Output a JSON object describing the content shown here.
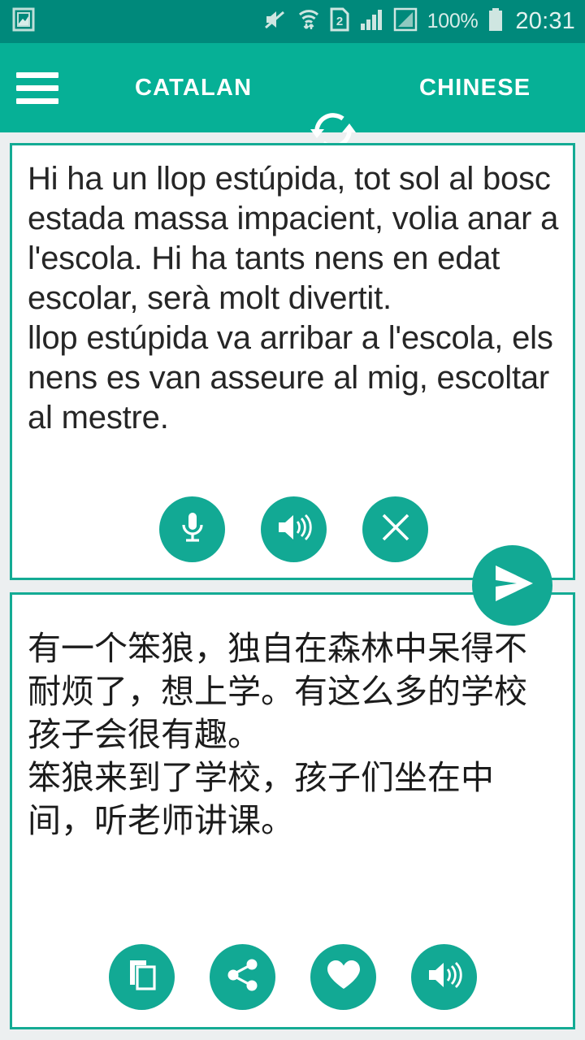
{
  "status_bar": {
    "notification_icon": "image-icon",
    "icons": [
      "mute-icon",
      "wifi-data-icon",
      "sim-2-icon",
      "signal-bars-icon",
      "signal-box-icon"
    ],
    "battery_percent": "100%",
    "battery_icon": "battery-full-icon",
    "time": "20:31",
    "background_color": "#00897b"
  },
  "app_bar": {
    "menu_icon": "hamburger-menu-icon",
    "source_language": "CATALAN",
    "swap_icon": "swap-languages-icon",
    "target_language": "CHINESE",
    "background_color": "#06b096"
  },
  "source_card": {
    "text": "Hi ha un llop estúpida, tot sol al bosc estada massa impacient, volia anar a l'escola. Hi ha tants nens en edat escolar, serà molt divertit.\nllop estúpida va arribar a l'escola, els nens es van asseure al mig, escoltar al mestre.",
    "border_color": "#14ab94",
    "actions": [
      {
        "name": "microphone-button",
        "icon": "microphone-icon",
        "label": "Voice input"
      },
      {
        "name": "speak-source-button",
        "icon": "speaker-icon",
        "label": "Listen"
      },
      {
        "name": "clear-text-button",
        "icon": "close-icon",
        "label": "Clear"
      }
    ]
  },
  "target_card": {
    "text": "有一个笨狼，独自在森林中呆得不耐烦了，想上学。有这么多的学校孩子会很有趣。\n笨狼来到了学校，孩子们坐在中间，听老师讲课。",
    "border_color": "#14ab94",
    "actions": [
      {
        "name": "copy-button",
        "icon": "copy-icon",
        "label": "Copy"
      },
      {
        "name": "share-button",
        "icon": "share-icon",
        "label": "Share"
      },
      {
        "name": "favorite-button",
        "icon": "heart-icon",
        "label": "Favorite"
      },
      {
        "name": "speak-target-button",
        "icon": "speaker-icon",
        "label": "Listen"
      }
    ]
  },
  "fab": {
    "icon": "send-icon",
    "label": "Translate",
    "color": "#12a994"
  },
  "theme": {
    "accent": "#12a994",
    "app_bar": "#06b096",
    "status_bar": "#00897b",
    "page_background": "#eceff0",
    "card_background": "#ffffff",
    "text_color": "#262626"
  }
}
